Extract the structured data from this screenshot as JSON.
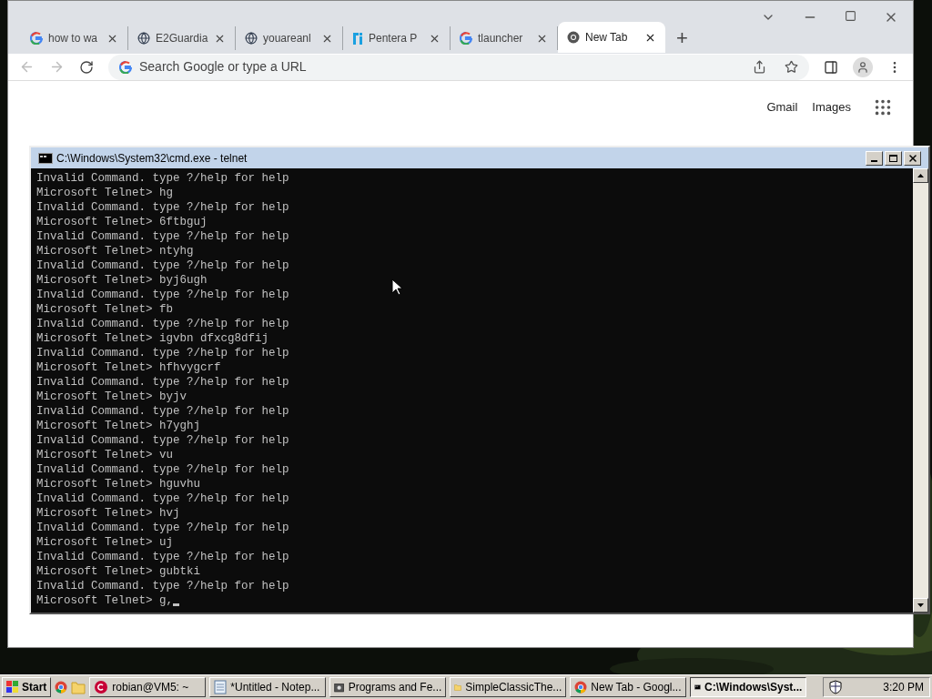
{
  "browser": {
    "tabs": [
      {
        "label": "how to wa",
        "selected": false
      },
      {
        "label": "E2Guardia",
        "selected": false
      },
      {
        "label": "youareanl",
        "selected": false
      },
      {
        "label": "Pentera P",
        "selected": false
      },
      {
        "label": "tlauncher",
        "selected": false
      },
      {
        "label": "New Tab",
        "selected": true
      }
    ],
    "new_tab": "+",
    "address": {
      "placeholder": "Search Google or type a URL"
    },
    "links": [
      "Gmail",
      "Images"
    ]
  },
  "console": {
    "title": "C:\\Windows\\System32\\cmd.exe - telnet",
    "lines": [
      "Invalid Command. type ?/help for help",
      "Microsoft Telnet> hg",
      "Invalid Command. type ?/help for help",
      "Microsoft Telnet> 6ftbguj",
      "Invalid Command. type ?/help for help",
      "Microsoft Telnet> ntyhg",
      "Invalid Command. type ?/help for help",
      "Microsoft Telnet> byj6ugh",
      "Invalid Command. type ?/help for help",
      "Microsoft Telnet> fb",
      "Invalid Command. type ?/help for help",
      "Microsoft Telnet> igvbn dfxcg8dfij",
      "Invalid Command. type ?/help for help",
      "Microsoft Telnet> hfhvygcrf",
      "Invalid Command. type ?/help for help",
      "Microsoft Telnet> byjv",
      "Invalid Command. type ?/help for help",
      "Microsoft Telnet> h7yghj",
      "Invalid Command. type ?/help for help",
      "Microsoft Telnet> vu",
      "Invalid Command. type ?/help for help",
      "Microsoft Telnet> hguvhu",
      "Invalid Command. type ?/help for help",
      "Microsoft Telnet> hvj",
      "Invalid Command. type ?/help for help",
      "Microsoft Telnet> uj",
      "Invalid Command. type ?/help for help",
      "Microsoft Telnet> gubtki",
      "Invalid Command. type ?/help for help"
    ],
    "prompt": "Microsoft Telnet> g,"
  },
  "taskbar": {
    "start": "Start",
    "items": [
      {
        "label": "robian@VM5: ~",
        "selected": false
      },
      {
        "label": "*Untitled - Notep...",
        "selected": false
      },
      {
        "label": "Programs and Fe...",
        "selected": false
      },
      {
        "label": "SimpleClassicThe...",
        "selected": false
      },
      {
        "label": "New Tab - Googl...",
        "selected": false
      },
      {
        "label": "C:\\Windows\\Syst...",
        "selected": true
      }
    ],
    "clock": "3:20 PM"
  }
}
